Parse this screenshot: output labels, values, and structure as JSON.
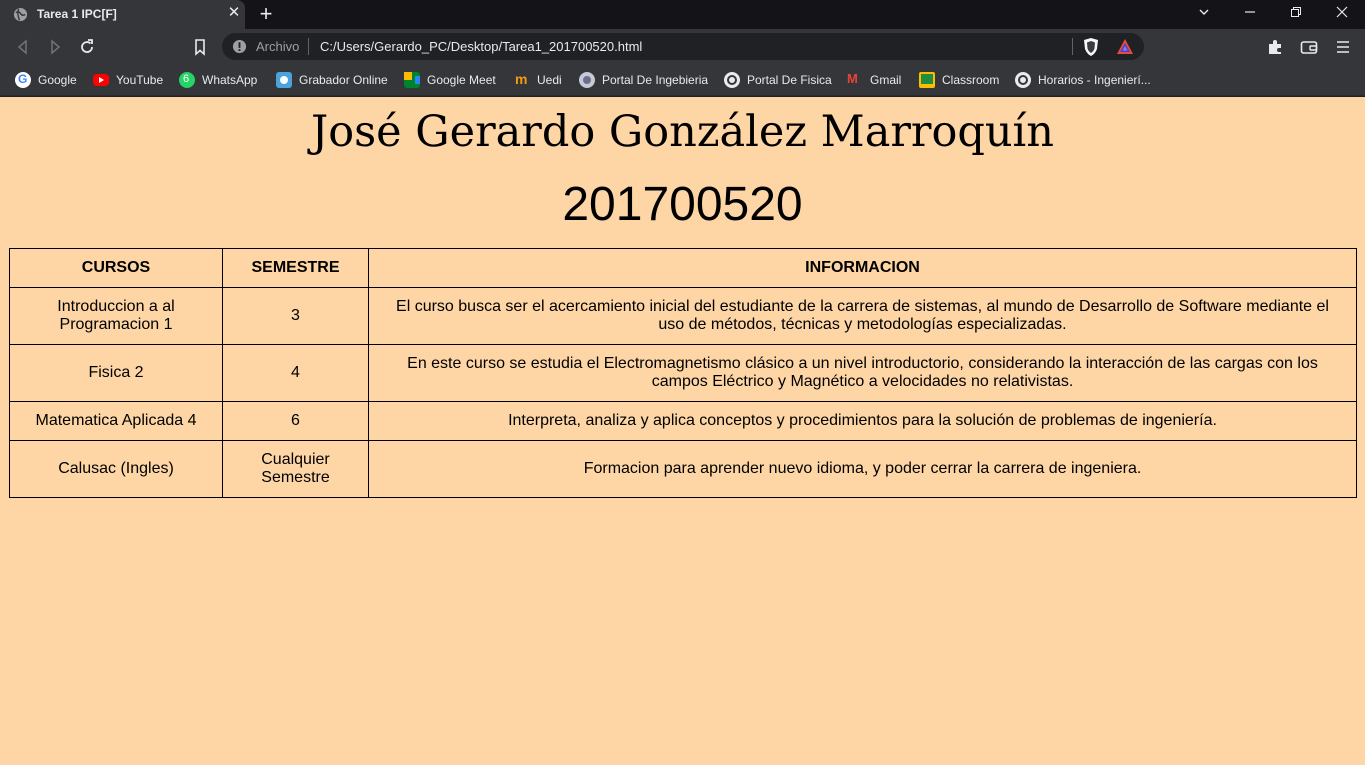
{
  "browser": {
    "tab": {
      "title": "Tarea 1 IPC[F]"
    },
    "omnibox": {
      "scheme_label": "Archivo",
      "url": "C:/Users/Gerardo_PC/Desktop/Tarea1_201700520.html"
    },
    "bookmarks": [
      {
        "label": "Google",
        "icon": "google-icon"
      },
      {
        "label": "YouTube",
        "icon": "youtube-icon"
      },
      {
        "label": "WhatsApp",
        "icon": "whatsapp-icon",
        "badge": "6"
      },
      {
        "label": "Grabador Online",
        "icon": "recorder-icon"
      },
      {
        "label": "Google Meet",
        "icon": "meet-icon"
      },
      {
        "label": "Uedi",
        "icon": "uedi-icon"
      },
      {
        "label": "Portal De Ingebieria",
        "icon": "globe-icon"
      },
      {
        "label": "Portal De Fisica",
        "icon": "globe-icon"
      },
      {
        "label": "Gmail",
        "icon": "gmail-icon"
      },
      {
        "label": "Classroom",
        "icon": "classroom-icon"
      },
      {
        "label": "Horarios - Ingenierí...",
        "icon": "globe-icon"
      }
    ]
  },
  "page": {
    "name": "José Gerardo González Marroquín",
    "carnet": "201700520",
    "table": {
      "headers": [
        "CURSOS",
        "SEMESTRE",
        "INFORMACION"
      ],
      "rows": [
        {
          "curso": "Introduccion a al Programacion 1",
          "semestre": "3",
          "informacion": "El curso busca ser el acercamiento inicial del estudiante de la carrera de sistemas, al mundo de Desarrollo de Software mediante el uso de métodos, técnicas y metodologías especializadas."
        },
        {
          "curso": "Fisica 2",
          "semestre": "4",
          "informacion": "En este curso se estudia el Electromagnetismo clásico a un nivel introductorio, considerando la interacción de las cargas con los campos Eléctrico y Magnético a velocidades no relativistas."
        },
        {
          "curso": "Matematica Aplicada 4",
          "semestre": "6",
          "informacion": "Interpreta, analiza y aplica conceptos y procedimientos para la solución de problemas de ingeniería."
        },
        {
          "curso": "Calusac (Ingles)",
          "semestre": "Cualquier Semestre",
          "informacion": "Formacion para aprender nuevo idioma, y poder cerrar la carrera de ingeniera."
        }
      ]
    }
  },
  "colors": {
    "page_background": "#fed6a5",
    "browser_frame": "#35363a"
  }
}
